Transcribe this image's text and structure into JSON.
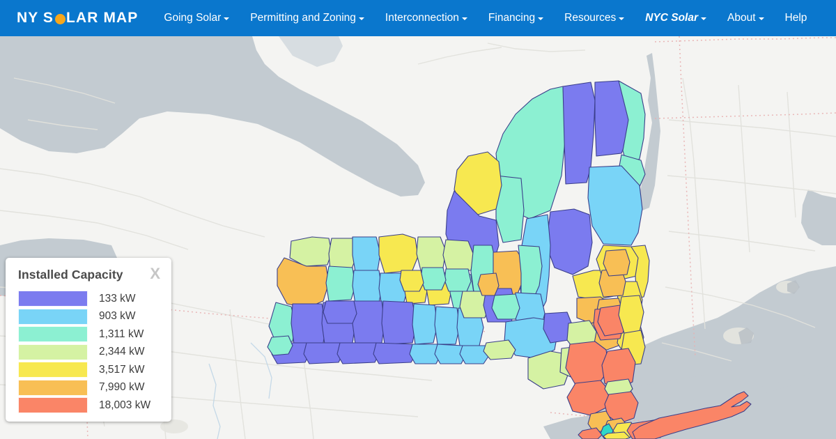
{
  "brand": {
    "part1": "NY S",
    "sun_icon": "sun-circle-icon",
    "part2": "LAR MAP",
    "full": "NY SOLAR MAP"
  },
  "nav": {
    "items": [
      {
        "label": "Going Solar",
        "caret": true,
        "italic": false
      },
      {
        "label": "Permitting and Zoning",
        "caret": true,
        "italic": false
      },
      {
        "label": "Interconnection",
        "caret": true,
        "italic": false
      },
      {
        "label": "Financing",
        "caret": true,
        "italic": false
      },
      {
        "label": "Resources",
        "caret": true,
        "italic": false
      },
      {
        "label": "NYC Solar",
        "caret": true,
        "italic": true
      },
      {
        "label": "About",
        "caret": true,
        "italic": false
      },
      {
        "label": "Help",
        "caret": false,
        "italic": false
      }
    ]
  },
  "legend": {
    "title": "Installed Capacity",
    "close_label": "X",
    "close_icon": "close-x-icon",
    "items": [
      {
        "label": "133 kW",
        "color": "#7b7bef"
      },
      {
        "label": "903 kW",
        "color": "#79d4f7"
      },
      {
        "label": "1,311 kW",
        "color": "#8cf0d2"
      },
      {
        "label": "2,344 kW",
        "color": "#d5f2a3"
      },
      {
        "label": "3,517 kW",
        "color": "#f7e850"
      },
      {
        "label": "7,990 kW",
        "color": "#f8bf55"
      },
      {
        "label": "18,003 kW",
        "color": "#fa8567"
      }
    ]
  },
  "colors": {
    "navbar_blue": "#0a77cd",
    "brand_white": "#ffffff",
    "sun_orange": "#f7a71c",
    "legend_bg": "#ffffff",
    "legend_title": "#4a4a4a",
    "basemap_land": "#f4f4f2",
    "basemap_water": "#c3cbd1",
    "county_border": "#3b3f8a"
  },
  "map": {
    "name": "new-york-state-county-choropleth",
    "region_label": "New York State counties colored by installed solar capacity",
    "classes": [
      "133 kW",
      "903 kW",
      "1,311 kW",
      "2,344 kW",
      "3,517 kW",
      "7,990 kW",
      "18,003 kW"
    ]
  },
  "chart_data": {
    "type": "map",
    "title": "Installed Capacity",
    "legend_position": "bottom-left",
    "categories": [
      "133 kW",
      "903 kW",
      "1,311 kW",
      "2,344 kW",
      "3,517 kW",
      "7,990 kW",
      "18,003 kW"
    ],
    "values": [
      133,
      903,
      1311,
      2344,
      3517,
      7990,
      18003
    ],
    "unit": "kW",
    "palette": [
      "#7b7bef",
      "#79d4f7",
      "#8cf0d2",
      "#d5f2a3",
      "#f7e850",
      "#f8bf55",
      "#fa8567"
    ]
  }
}
